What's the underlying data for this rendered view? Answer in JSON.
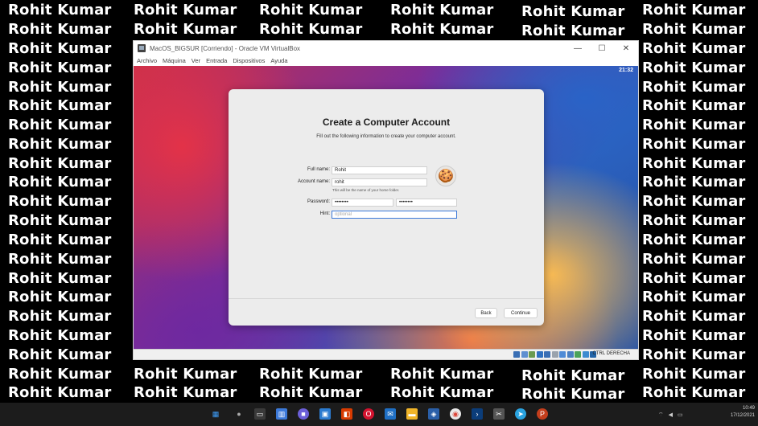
{
  "watermark": {
    "text": "Rohit Kumar"
  },
  "virtualbox": {
    "title": "MacOS_BIGSUR [Corriendo] - Oracle VM VirtualBox",
    "controls": {
      "minimize": "—",
      "maximize": "☐",
      "close": "✕"
    },
    "menu": [
      "Archivo",
      "Máquina",
      "Ver",
      "Entrada",
      "Dispositivos",
      "Ayuda"
    ],
    "status_key": "CTRL DERECHA"
  },
  "guest": {
    "clock": "21:32",
    "dialog": {
      "title": "Create a Computer Account",
      "subtitle": "Fill out the following information to create your computer account.",
      "full_name_label": "Full name:",
      "full_name_value": "Rohit",
      "account_name_label": "Account name:",
      "account_name_value": "rohit",
      "account_name_note": "This will be the name of your home folder.",
      "password_label": "Password:",
      "password_value": "••••••••",
      "verify_value": "••••••••",
      "hint_label": "Hint:",
      "hint_placeholder": "optional",
      "avatar_icon": "gingerbread-icon",
      "back_label": "Back",
      "continue_label": "Continue"
    }
  },
  "taskbar": {
    "icons": [
      "windows-start-icon",
      "search-icon",
      "task-view-icon",
      "widgets-icon",
      "chat-icon",
      "store-icon",
      "office-icon",
      "opera-icon",
      "mail-icon",
      "explorer-icon",
      "virtualbox-icon",
      "chrome-icon",
      "terminal-icon",
      "app-icon",
      "telegram-icon",
      "powerpoint-icon"
    ],
    "time": "10:49",
    "date": "17/12/2021"
  }
}
